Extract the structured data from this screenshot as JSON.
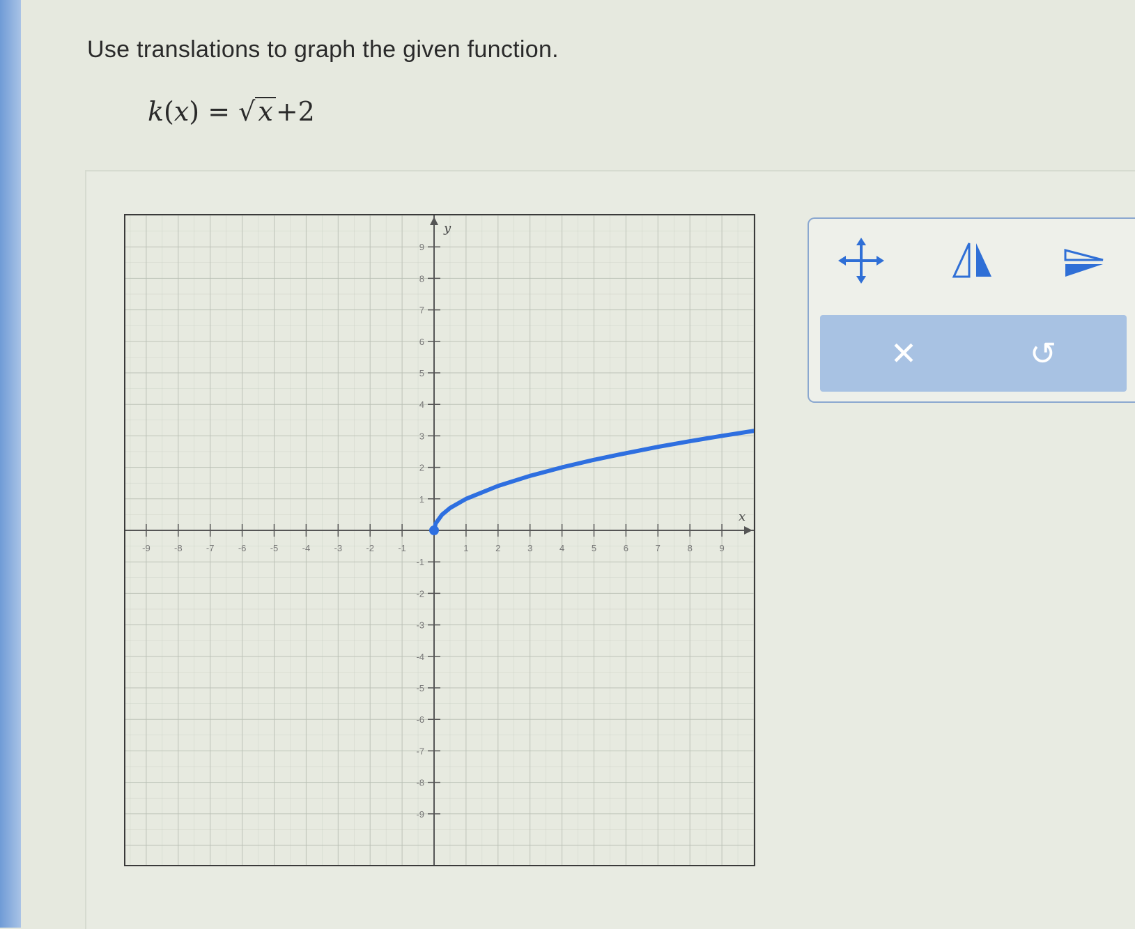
{
  "question": {
    "prompt": "Use translations to graph the given function.",
    "equation": {
      "fname": "k",
      "arg": "x",
      "equals": "=",
      "radicand": "x",
      "suffix": "+2"
    }
  },
  "graph": {
    "xlabel": "x",
    "ylabel": "y",
    "xlim": [
      -10,
      10
    ],
    "ylim": [
      -10,
      10
    ],
    "grid": true,
    "x_tick_labels": [
      "-9",
      "-8",
      "-7",
      "-6",
      "-5",
      "-4",
      "-3",
      "-2",
      "-1",
      "1",
      "2",
      "3",
      "4",
      "5",
      "6",
      "7",
      "8",
      "9"
    ],
    "y_tick_labels": [
      "9",
      "8",
      "7",
      "6",
      "5",
      "4",
      "3",
      "2",
      "1",
      "-1",
      "-2",
      "-3",
      "-4",
      "-5",
      "-6",
      "-7",
      "-8",
      "-9"
    ],
    "colors": {
      "curve": "#2e6fe0",
      "grid": "#b9bfb4",
      "axis": "#555555",
      "frame": "#3a3a3a"
    }
  },
  "chart_data": {
    "type": "line",
    "title": "",
    "xlabel": "x",
    "ylabel": "y",
    "xlim": [
      -10,
      10
    ],
    "ylim": [
      -10,
      10
    ],
    "grid": true,
    "series": [
      {
        "x": [
          0,
          0.05,
          0.25,
          0.5,
          1,
          2,
          3,
          4,
          5,
          6,
          7,
          8,
          9,
          10
        ],
        "y": [
          0,
          0.22,
          0.5,
          0.71,
          1,
          1.41,
          1.73,
          2,
          2.24,
          2.45,
          2.65,
          2.83,
          3,
          3.16
        ],
        "endpoint": [
          0,
          0
        ]
      }
    ]
  },
  "toolbar": {
    "tools": [
      {
        "name": "move-icon"
      },
      {
        "name": "reflect-icon"
      },
      {
        "name": "stretch-icon"
      }
    ],
    "actions": [
      {
        "name": "clear-icon",
        "glyph": "✕"
      },
      {
        "name": "undo-icon",
        "glyph": "↺"
      }
    ],
    "colors": {
      "tool_accent": "#2f6fd6",
      "action_bg": "#a8c2e3"
    }
  }
}
